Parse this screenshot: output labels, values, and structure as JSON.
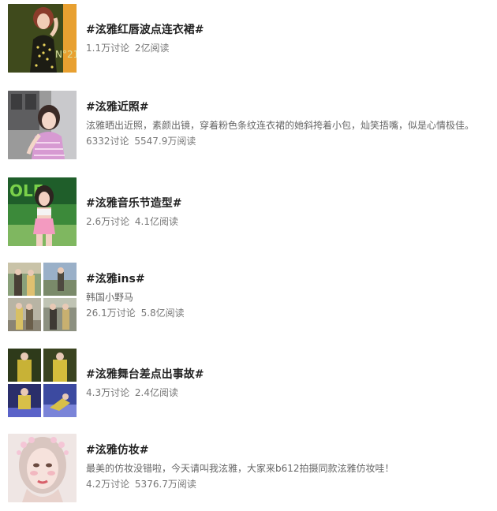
{
  "topics": [
    {
      "title": "#泫雅红唇波点连衣裙#",
      "desc": "",
      "discuss": "1.1万讨论",
      "reads": "2亿阅读",
      "thumb": "photo-woman-polka-dot-dress"
    },
    {
      "title": "#泫雅近照#",
      "desc": "泫雅晒出近照，素颜出镜，穿着粉色条纹连衣裙的她斜挎着小包，灿笑捂嘴，似是心情极佳。",
      "discuss": "6332讨论",
      "reads": "5547.9万阅读",
      "thumb": "photo-woman-pink-dress"
    },
    {
      "title": "#泫雅音乐节造型#",
      "desc": "",
      "discuss": "2.6万讨论",
      "reads": "4.1亿阅读",
      "thumb": "photo-woman-stage-green"
    },
    {
      "title": "#泫雅ins#",
      "desc": "韩国小野马",
      "discuss": "26.1万讨论",
      "reads": "5.8亿阅读",
      "thumb": "photo-grid-street"
    },
    {
      "title": "#泫雅舞台差点出事故#",
      "desc": "",
      "discuss": "4.3万讨论",
      "reads": "2.4亿阅读",
      "thumb": "photo-grid-stage"
    },
    {
      "title": "#泫雅仿妆#",
      "desc": "最美的仿妆没错啦，今天请叫我泫雅，大家来b612拍摄同款泫雅仿妆哇！",
      "discuss": "4.2万讨论",
      "reads": "5376.7万阅读",
      "thumb": "photo-makeup-portrait"
    }
  ]
}
